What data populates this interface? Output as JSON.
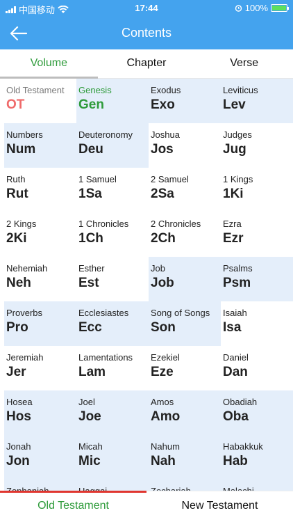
{
  "status_bar": {
    "carrier": "中国移动",
    "time": "17:44",
    "battery": "100%",
    "battery_level": 1.0
  },
  "nav": {
    "title": "Contents"
  },
  "tabs": [
    {
      "label": "Volume",
      "active": true
    },
    {
      "label": "Chapter",
      "active": false
    },
    {
      "label": "Verse",
      "active": false
    }
  ],
  "books": [
    {
      "name": "Old Testament",
      "abbr": "OT",
      "style": "ot",
      "highlight": false
    },
    {
      "name": "Genesis",
      "abbr": "Gen",
      "style": "sel",
      "highlight": true
    },
    {
      "name": "Exodus",
      "abbr": "Exo",
      "style": "",
      "highlight": true
    },
    {
      "name": "Leviticus",
      "abbr": "Lev",
      "style": "",
      "highlight": true
    },
    {
      "name": "Numbers",
      "abbr": "Num",
      "style": "",
      "highlight": true
    },
    {
      "name": "Deuteronomy",
      "abbr": "Deu",
      "style": "",
      "highlight": true
    },
    {
      "name": "Joshua",
      "abbr": "Jos",
      "style": "",
      "highlight": false
    },
    {
      "name": "Judges",
      "abbr": "Jug",
      "style": "",
      "highlight": false
    },
    {
      "name": "Ruth",
      "abbr": "Rut",
      "style": "",
      "highlight": false
    },
    {
      "name": "1 Samuel",
      "abbr": "1Sa",
      "style": "",
      "highlight": false
    },
    {
      "name": "2 Samuel",
      "abbr": "2Sa",
      "style": "",
      "highlight": false
    },
    {
      "name": "1 Kings",
      "abbr": "1Ki",
      "style": "",
      "highlight": false
    },
    {
      "name": "2 Kings",
      "abbr": "2Ki",
      "style": "",
      "highlight": false
    },
    {
      "name": "1 Chronicles",
      "abbr": "1Ch",
      "style": "",
      "highlight": false
    },
    {
      "name": "2 Chronicles",
      "abbr": "2Ch",
      "style": "",
      "highlight": false
    },
    {
      "name": "Ezra",
      "abbr": "Ezr",
      "style": "",
      "highlight": false
    },
    {
      "name": "Nehemiah",
      "abbr": "Neh",
      "style": "",
      "highlight": false
    },
    {
      "name": "Esther",
      "abbr": "Est",
      "style": "",
      "highlight": false
    },
    {
      "name": "Job",
      "abbr": "Job",
      "style": "",
      "highlight": true
    },
    {
      "name": "Psalms",
      "abbr": "Psm",
      "style": "",
      "highlight": true
    },
    {
      "name": "Proverbs",
      "abbr": "Pro",
      "style": "",
      "highlight": true
    },
    {
      "name": "Ecclesiastes",
      "abbr": "Ecc",
      "style": "",
      "highlight": true
    },
    {
      "name": "Song of Songs",
      "abbr": "Son",
      "style": "",
      "highlight": true
    },
    {
      "name": "Isaiah",
      "abbr": "Isa",
      "style": "",
      "highlight": false
    },
    {
      "name": "Jeremiah",
      "abbr": "Jer",
      "style": "",
      "highlight": false
    },
    {
      "name": "Lamentations",
      "abbr": "Lam",
      "style": "",
      "highlight": false
    },
    {
      "name": "Ezekiel",
      "abbr": "Eze",
      "style": "",
      "highlight": false
    },
    {
      "name": "Daniel",
      "abbr": "Dan",
      "style": "",
      "highlight": false
    },
    {
      "name": "Hosea",
      "abbr": "Hos",
      "style": "",
      "highlight": true
    },
    {
      "name": "Joel",
      "abbr": "Joe",
      "style": "",
      "highlight": true
    },
    {
      "name": "Amos",
      "abbr": "Amo",
      "style": "",
      "highlight": true
    },
    {
      "name": "Obadiah",
      "abbr": "Oba",
      "style": "",
      "highlight": true
    },
    {
      "name": "Jonah",
      "abbr": "Jon",
      "style": "",
      "highlight": true
    },
    {
      "name": "Micah",
      "abbr": "Mic",
      "style": "",
      "highlight": true
    },
    {
      "name": "Nahum",
      "abbr": "Nah",
      "style": "",
      "highlight": true
    },
    {
      "name": "Habakkuk",
      "abbr": "Hab",
      "style": "",
      "highlight": true
    },
    {
      "name": "Zephaniah",
      "abbr": "",
      "style": "",
      "highlight": true
    },
    {
      "name": "Haggai",
      "abbr": "",
      "style": "",
      "highlight": true
    },
    {
      "name": "Zechariah",
      "abbr": "",
      "style": "",
      "highlight": true
    },
    {
      "name": "Malachi",
      "abbr": "",
      "style": "",
      "highlight": true
    }
  ],
  "bottom_tabs": [
    {
      "label": "Old Testament",
      "active": true
    },
    {
      "label": "New Testament",
      "active": false
    }
  ],
  "colors": {
    "header_blue": "#44a3ee",
    "selected_green": "#2e9b3a",
    "ot_red": "#ef6a6a",
    "highlight_bg": "#e4eefa",
    "indicator_red": "#e0362f"
  }
}
